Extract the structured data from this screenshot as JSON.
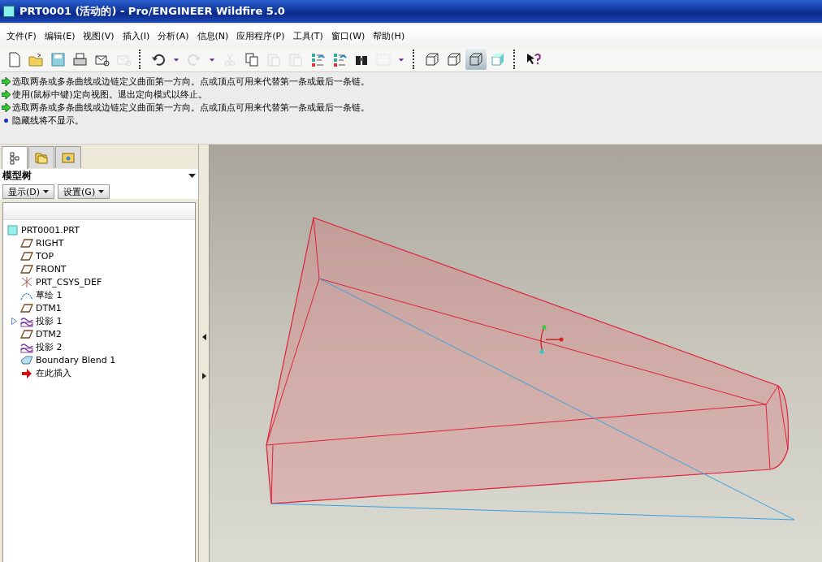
{
  "window": {
    "title": "PRT0001 (活动的) - Pro/ENGINEER Wildfire 5.0"
  },
  "menu": [
    "文件(F)",
    "编辑(E)",
    "视图(V)",
    "插入(I)",
    "分析(A)",
    "信息(N)",
    "应用程序(P)",
    "工具(T)",
    "窗口(W)",
    "帮助(H)"
  ],
  "toolbar": [
    [
      {
        "kind": "new",
        "disabled": false
      },
      {
        "kind": "open",
        "disabled": false
      },
      {
        "kind": "save",
        "disabled": false
      },
      {
        "kind": "print",
        "disabled": false
      },
      {
        "kind": "mail",
        "disabled": false
      },
      {
        "kind": "mail",
        "disabled": true
      }
    ],
    [
      {
        "kind": "undo",
        "disabled": false
      },
      {
        "kind": "caret",
        "disabled": false
      },
      {
        "kind": "redo",
        "disabled": true
      },
      {
        "kind": "caret",
        "disabled": false
      },
      {
        "kind": "cut",
        "disabled": true
      },
      {
        "kind": "copy",
        "disabled": false
      },
      {
        "kind": "paste",
        "disabled": true
      },
      {
        "kind": "paste",
        "disabled": true
      },
      {
        "kind": "regen",
        "disabled": false
      },
      {
        "kind": "regen",
        "disabled": false
      },
      {
        "kind": "find",
        "disabled": false
      },
      {
        "kind": "select",
        "disabled": true
      },
      {
        "kind": "caret",
        "disabled": false
      }
    ],
    [
      {
        "kind": "cube",
        "selected": false
      },
      {
        "kind": "cube",
        "selected": false
      },
      {
        "kind": "cube",
        "selected": true
      },
      {
        "kind": "shaded",
        "selected": false
      }
    ],
    [
      {
        "kind": "help",
        "disabled": false
      }
    ]
  ],
  "messages": [
    {
      "kind": "prompt",
      "text": "选取两条或多条曲线或边链定义曲面第一方向。点或顶点可用来代替第一条或最后一条链。"
    },
    {
      "kind": "prompt",
      "text": "使用(鼠标中键)定向视图。退出定向模式以终止。"
    },
    {
      "kind": "prompt",
      "text": "选取两条或多条曲线或边链定义曲面第一方向。点或顶点可用来代替第一条或最后一条链。"
    },
    {
      "kind": "info",
      "text": "隐藏线将不显示。"
    }
  ],
  "panel_tabs": [
    {
      "kind": "tree",
      "selected": true
    },
    {
      "kind": "folders",
      "selected": false
    },
    {
      "kind": "favorites",
      "selected": false
    }
  ],
  "model_tree": {
    "title": "模型树",
    "buttons": [
      "显示(D)",
      "设置(G)"
    ],
    "root": {
      "label": "PRT0001.PRT",
      "kind": "part",
      "children": [
        {
          "label": "RIGHT",
          "kind": "plane",
          "expandable": false
        },
        {
          "label": "TOP",
          "kind": "plane",
          "expandable": false
        },
        {
          "label": "FRONT",
          "kind": "plane",
          "expandable": false
        },
        {
          "label": "PRT_CSYS_DEF",
          "kind": "csys",
          "expandable": false
        },
        {
          "label": "草绘 1",
          "kind": "sketch",
          "expandable": false
        },
        {
          "label": "DTM1",
          "kind": "plane",
          "expandable": false
        },
        {
          "label": "投影 1",
          "kind": "projection",
          "expandable": true
        },
        {
          "label": "DTM2",
          "kind": "plane",
          "expandable": false
        },
        {
          "label": "投影 2",
          "kind": "projection",
          "expandable": false
        },
        {
          "label": "Boundary Blend 1",
          "kind": "blend",
          "expandable": false
        },
        {
          "label": "在此插入",
          "kind": "insert",
          "expandable": false
        }
      ]
    }
  }
}
